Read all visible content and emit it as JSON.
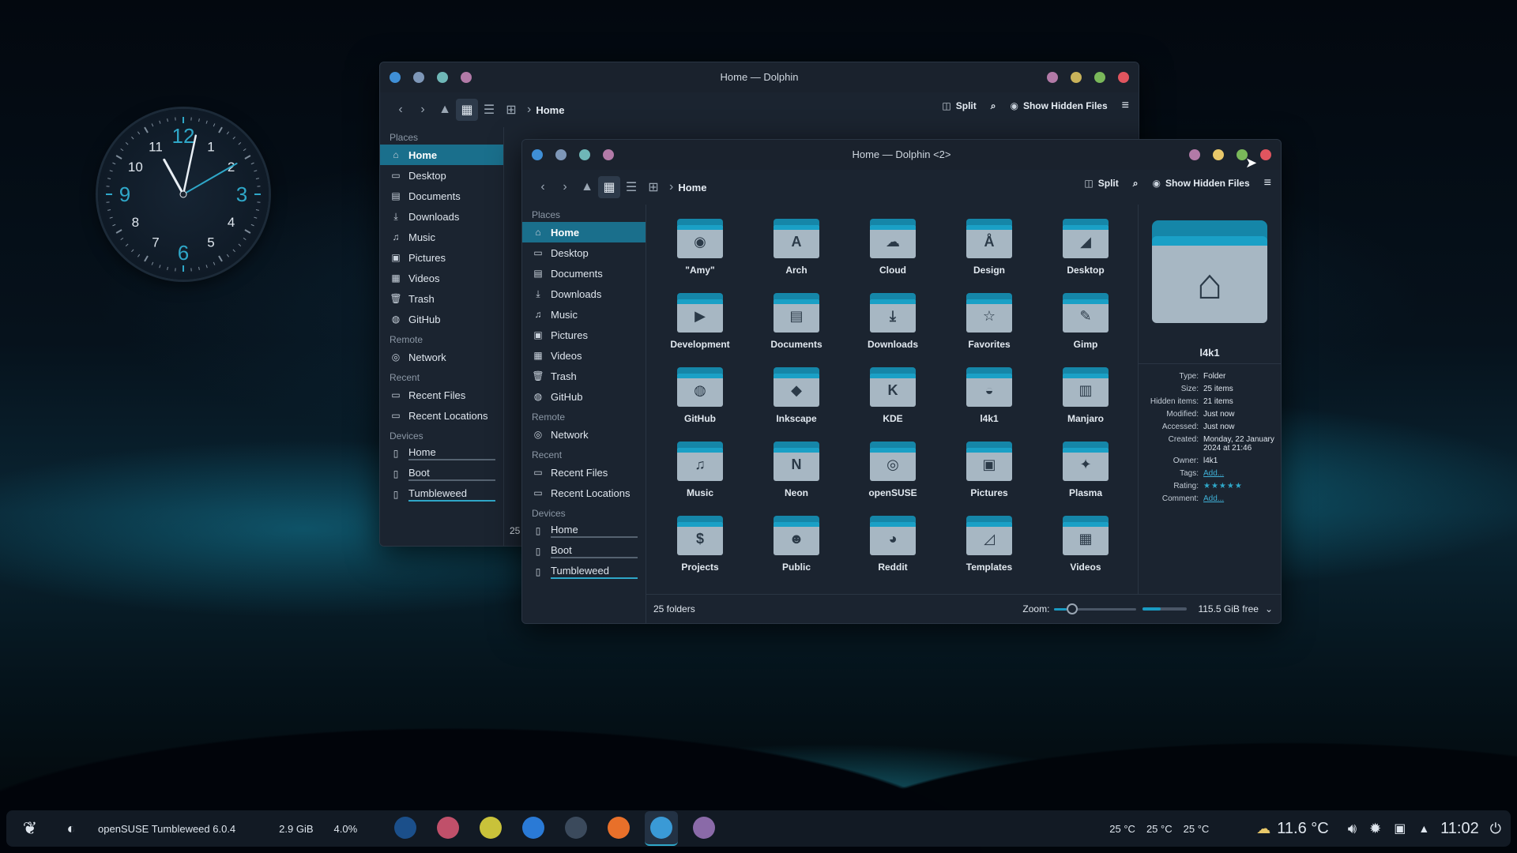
{
  "clock": {
    "numbers": [
      "12",
      "1",
      "2",
      "3",
      "4",
      "5",
      "6",
      "7",
      "8",
      "9",
      "10",
      "11"
    ],
    "time": "11:02"
  },
  "back_window": {
    "title": "Home — Dolphin",
    "breadcrumb": "Home",
    "toolbar": {
      "split": "Split",
      "hidden": "Show Hidden Files"
    },
    "places_label": "Places",
    "places": [
      "Home",
      "Desktop",
      "Documents",
      "Downloads",
      "Music",
      "Pictures",
      "Videos",
      "Trash",
      "GitHub"
    ],
    "remote_label": "Remote",
    "remote": [
      "Network"
    ],
    "recent_label": "Recent",
    "recent": [
      "Recent Files",
      "Recent Locations"
    ],
    "devices_label": "Devices",
    "devices": [
      "Home",
      "Boot",
      "Tumbleweed"
    ],
    "status": "25"
  },
  "front_window": {
    "title": "Home — Dolphin <2>",
    "breadcrumb": "Home",
    "toolbar": {
      "split": "Split",
      "hidden": "Show Hidden Files"
    },
    "places_label": "Places",
    "places": [
      "Home",
      "Desktop",
      "Documents",
      "Downloads",
      "Music",
      "Pictures",
      "Videos",
      "Trash",
      "GitHub"
    ],
    "remote_label": "Remote",
    "remote": [
      "Network"
    ],
    "recent_label": "Recent",
    "recent": [
      "Recent Files",
      "Recent Locations"
    ],
    "devices_label": "Devices",
    "devices": [
      "Home",
      "Boot",
      "Tumbleweed"
    ],
    "folders": [
      {
        "name": "\"Amy\"",
        "icon": "eye-icon",
        "glyph": "◉"
      },
      {
        "name": "Arch",
        "icon": "arch-icon",
        "glyph": "A"
      },
      {
        "name": "Cloud",
        "icon": "cloud-icon",
        "glyph": "☁"
      },
      {
        "name": "Design",
        "icon": "compass-icon",
        "glyph": "Å"
      },
      {
        "name": "Desktop",
        "icon": "desktop-icon",
        "glyph": "◢"
      },
      {
        "name": "Development",
        "icon": "play-icon",
        "glyph": "▶"
      },
      {
        "name": "Documents",
        "icon": "document-icon",
        "glyph": "▤"
      },
      {
        "name": "Downloads",
        "icon": "download-icon",
        "glyph": "⤓"
      },
      {
        "name": "Favorites",
        "icon": "star-icon",
        "glyph": "☆"
      },
      {
        "name": "Gimp",
        "icon": "gimp-icon",
        "glyph": "✎"
      },
      {
        "name": "GitHub",
        "icon": "github-icon",
        "glyph": "◍"
      },
      {
        "name": "Inkscape",
        "icon": "inkscape-icon",
        "glyph": "◆"
      },
      {
        "name": "KDE",
        "icon": "kde-icon",
        "glyph": "K"
      },
      {
        "name": "l4k1",
        "icon": "chameleon-icon",
        "glyph": "◒"
      },
      {
        "name": "Manjaro",
        "icon": "manjaro-icon",
        "glyph": "▥"
      },
      {
        "name": "Music",
        "icon": "music-icon",
        "glyph": "♫"
      },
      {
        "name": "Neon",
        "icon": "neon-icon",
        "glyph": "N"
      },
      {
        "name": "openSUSE",
        "icon": "opensuse-icon",
        "glyph": "◎"
      },
      {
        "name": "Pictures",
        "icon": "picture-icon",
        "glyph": "▣"
      },
      {
        "name": "Plasma",
        "icon": "plasma-icon",
        "glyph": "✦"
      },
      {
        "name": "Projects",
        "icon": "dollar-icon",
        "glyph": "$"
      },
      {
        "name": "Public",
        "icon": "users-icon",
        "glyph": "☻"
      },
      {
        "name": "Reddit",
        "icon": "reddit-icon",
        "glyph": "◕"
      },
      {
        "name": "Templates",
        "icon": "template-icon",
        "glyph": "◿"
      },
      {
        "name": "Videos",
        "icon": "film-icon",
        "glyph": "▦"
      }
    ],
    "info": {
      "name": "l4k1",
      "rows": [
        {
          "k": "Type:",
          "v": "Folder"
        },
        {
          "k": "Size:",
          "v": "25 items"
        },
        {
          "k": "Hidden items:",
          "v": "21 items"
        },
        {
          "k": "Modified:",
          "v": "Just now"
        },
        {
          "k": "Accessed:",
          "v": "Just now"
        },
        {
          "k": "Created:",
          "v": "Monday, 22 January 2024 at 21:46"
        },
        {
          "k": "Owner:",
          "v": "l4k1"
        },
        {
          "k": "Tags:",
          "v": "Add..."
        },
        {
          "k": "Rating:",
          "v": ""
        },
        {
          "k": "Comment:",
          "v": "Add..."
        }
      ]
    },
    "status": {
      "count": "25 folders",
      "zoom_label": "Zoom:",
      "free": "115.5 GiB free",
      "zoom_level": 0.15
    }
  },
  "taskbar": {
    "system_name": "openSUSE Tumbleweed 6.0.4",
    "mem": "2.9 GiB",
    "cpu": "4.0%",
    "temps": [
      "25 °C",
      "25 °C",
      "25 °C"
    ],
    "weather": "11.6 °C",
    "time": "11:02"
  },
  "colors": {
    "accent": "#1a6f8c",
    "folder_tab": "#1586a8",
    "close": "#e0555f",
    "minimize": "#e8c86a",
    "maximize": "#7ab85a"
  }
}
